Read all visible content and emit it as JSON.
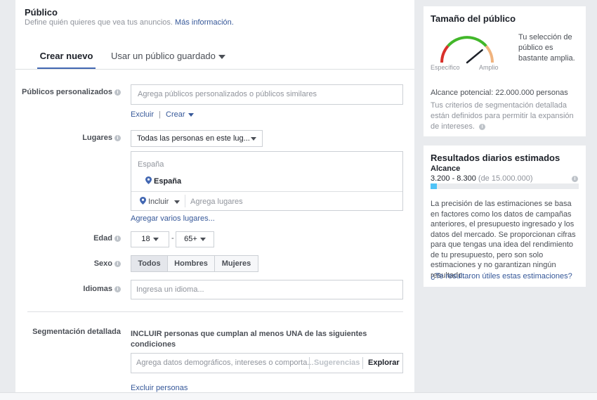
{
  "header": {
    "title": "Público",
    "subtitle": "Define quién quieres que vea tus anuncios.",
    "more_link": "Más información."
  },
  "tabs": [
    {
      "label": "Crear nuevo"
    },
    {
      "label": "Usar un público guardado"
    }
  ],
  "custom_audiences": {
    "label": "Públicos personalizados",
    "placeholder": "Agrega públicos personalizados o públicos similares",
    "exclude_link": "Excluir",
    "separator": "|",
    "create_link": "Crear"
  },
  "locations": {
    "label": "Lugares",
    "dropdown_value": "Todas las personas en este lug...",
    "country_header": "España",
    "selected_location": "España",
    "include_value": "Incluir",
    "add_placeholder": "Agrega lugares",
    "add_multiple_link": "Agregar varios lugares..."
  },
  "age": {
    "label": "Edad",
    "min": "18",
    "dash": "-",
    "max": "65+"
  },
  "gender": {
    "label": "Sexo",
    "options": [
      "Todos",
      "Hombres",
      "Mujeres"
    ]
  },
  "languages": {
    "label": "Idiomas",
    "placeholder": "Ingresa un idioma..."
  },
  "detailed_targeting": {
    "label": "Segmentación detallada",
    "description": "INCLUIR personas que cumplan al menos UNA de las siguientes condiciones",
    "placeholder": "Agrega datos demográficos, intereses o comporta...",
    "suggestions_label": "Sugerencias",
    "explore_label": "Explorar",
    "exclude_link": "Excluir personas"
  },
  "audience_size": {
    "title": "Tamaño del público",
    "gauge_left": "Específico",
    "gauge_right": "Amplio",
    "gauge_level": 0.78,
    "description": "Tu selección de público es bastante amplia.",
    "potential_reach": "Alcance potencial: 22.000.000 personas",
    "note": "Tus criterios de segmentación detallada están definidos para permitir la expansión de intereses."
  },
  "daily_results": {
    "title": "Resultados diarios estimados",
    "reach_label": "Alcance",
    "reach_range": "3.200 - 8.300",
    "reach_total": "(de 15.000.000)",
    "reach_fraction": 0.045,
    "note": "La precisión de las estimaciones se basa en factores como los datos de campañas anteriores, el presupuesto ingresado y los datos del mercado. Se proporcionan cifras para que tengas una idea del rendimiento de tu presupuesto, pero son solo estimaciones y no garantizan ningún resultado.",
    "feedback_link": "¿Te resultaron útiles estas estimaciones?"
  },
  "colors": {
    "link": "#365899",
    "tab_active": "#4267b2",
    "reach_bar": "#4fc3f7",
    "gauge_red": "#d9302a",
    "gauge_green": "#42b72a",
    "gauge_orange": "#f0b37e"
  }
}
